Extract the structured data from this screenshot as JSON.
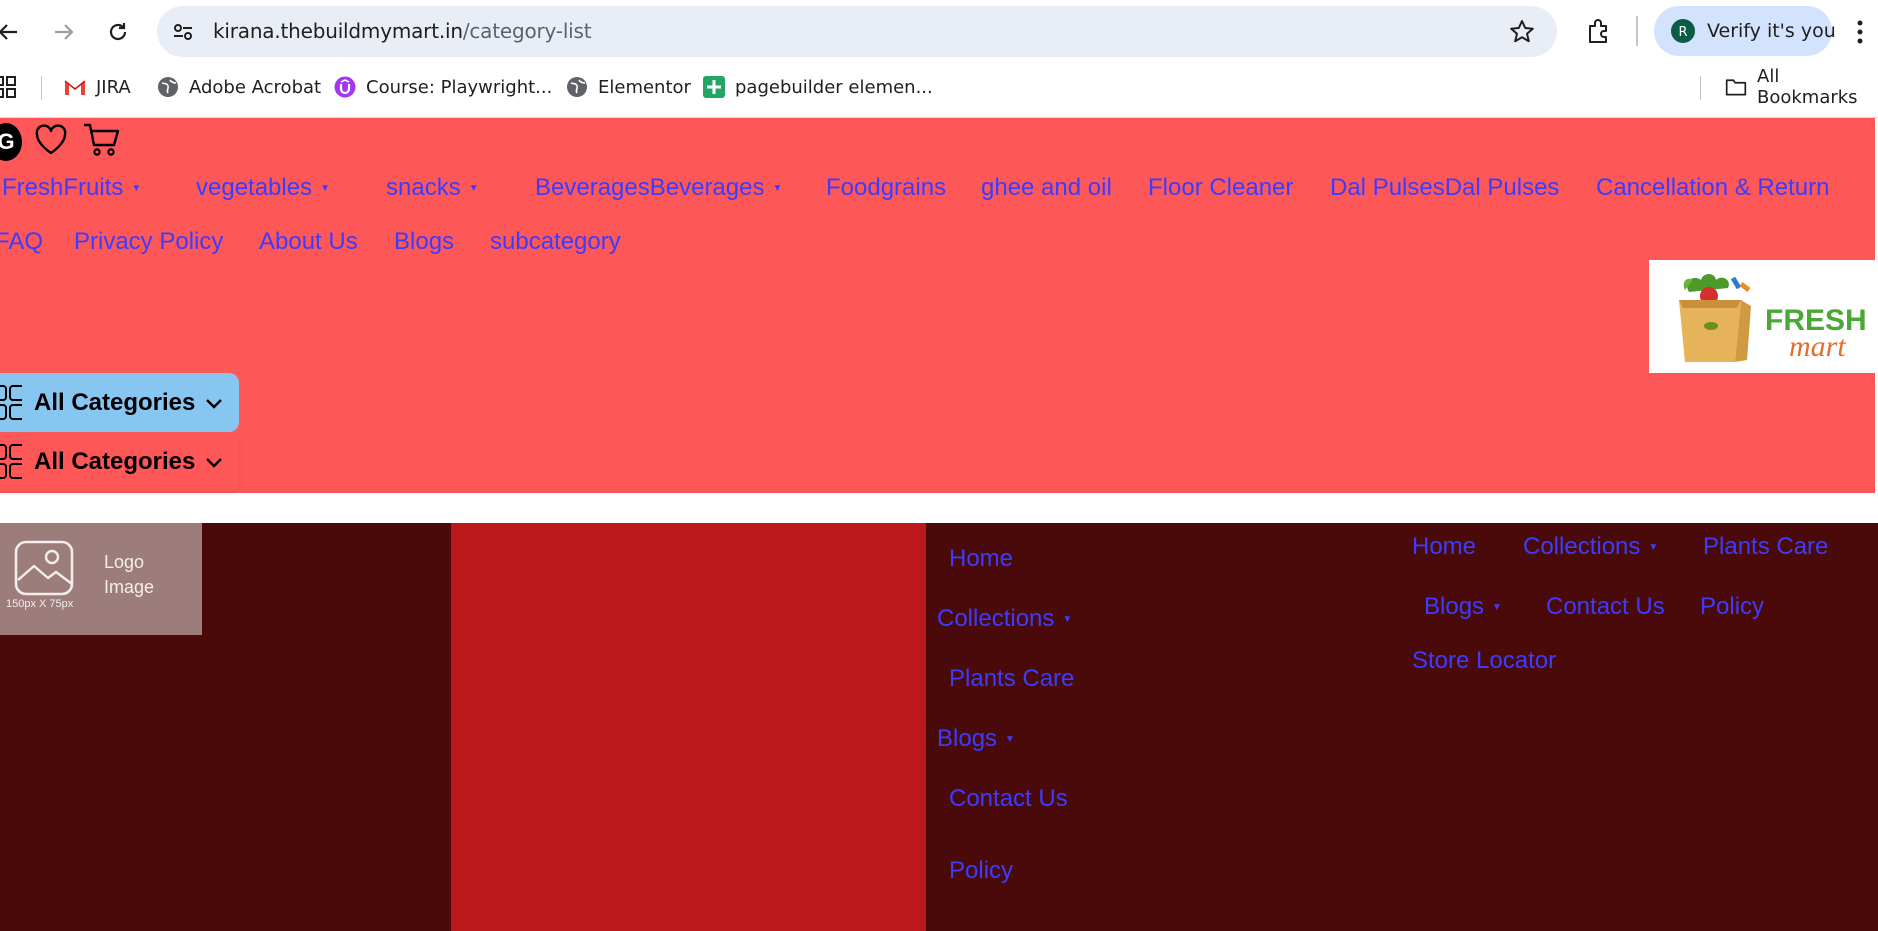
{
  "browser": {
    "url_host": "kirana.thebuildmymart.in",
    "url_path": "/category-list",
    "verify_avatar": "R",
    "verify_label": "Verify it's you",
    "bookmarks": [
      "JIRA",
      "Adobe Acrobat",
      "Course: Playwright...",
      "Elementor",
      "pagebuilder elemen..."
    ],
    "all_bookmarks_label": "All Bookmarks"
  },
  "header": {
    "badge": "G",
    "menu_row1": [
      "FreshFruits",
      "vegetables",
      "snacks",
      "BeveragesBeverages",
      "Foodgrains",
      "ghee and oil",
      "Floor Cleaner",
      "Dal PulsesDal Pulses",
      "Cancellation & Return"
    ],
    "menu_row2": [
      "FAQ",
      "Privacy Policy",
      "About Us",
      "Blogs",
      "subcategory"
    ],
    "logo_word1": "FRESH",
    "logo_word2": "mart",
    "category_label": "All Categories",
    "category_label_2": "All Categories"
  },
  "footer": {
    "logo_placeholder_title": "Logo Image",
    "logo_placeholder_size": "150px X 75px",
    "menu_vertical": [
      "Home",
      "Collections",
      "Plants Care",
      "Blogs",
      "Contact Us",
      "Policy"
    ],
    "menu_horizontal": [
      "Home",
      "Collections",
      "Plants Care",
      "Blogs",
      "Contact Us",
      "Policy",
      "Store Locator"
    ]
  },
  "colors": {
    "header_bg": "#fe5757",
    "link": "#3c3cff",
    "footer_dark": "#4a0a0a",
    "footer_red": "#bb1919",
    "category_button": "#87c6f0"
  }
}
